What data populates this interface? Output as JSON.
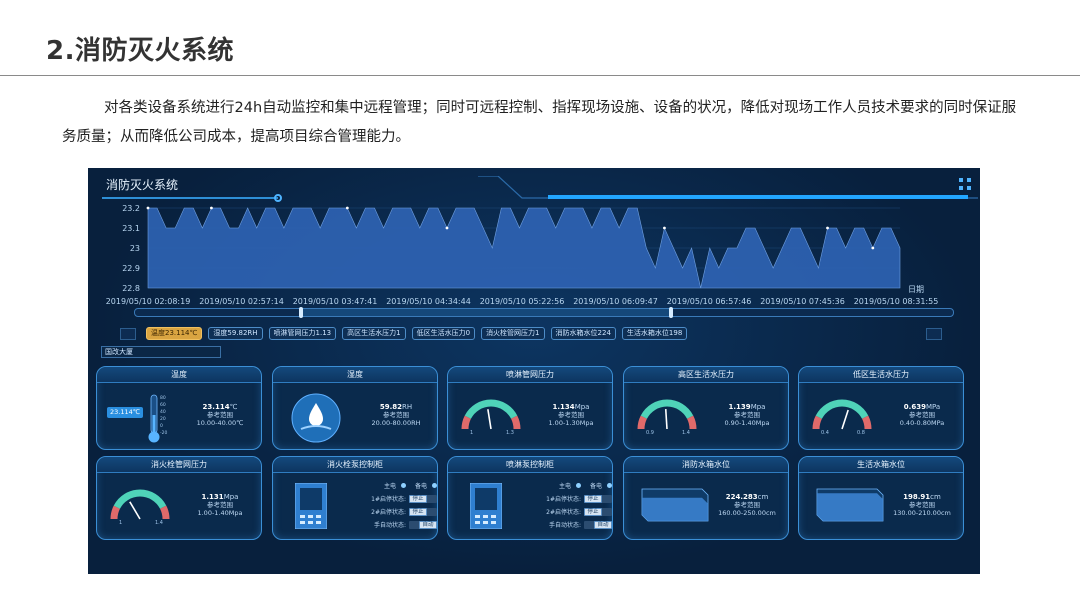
{
  "document": {
    "heading": "2.消防灭火系统",
    "paragraph": "对各类设备系统进行24h自动监控和集中远程管理；同时可远程控制、指挥现场设施、设备的状况，降低对现场工作人员技术要求的同时保证服务质量；从而降低公司成本，提高项目综合管理能力。"
  },
  "dashboard": {
    "title": "消防灭火系统",
    "area_input": "国改大厦",
    "tabs": [
      {
        "label": "温度23.114℃",
        "active": true
      },
      {
        "label": "湿度59.82RH",
        "active": false
      },
      {
        "label": "喷淋管网压力1.13",
        "active": false
      },
      {
        "label": "高区生活水压力1",
        "active": false
      },
      {
        "label": "低区生活水压力0",
        "active": false
      },
      {
        "label": "消火栓管网压力1",
        "active": false
      },
      {
        "label": "消防水箱水位224",
        "active": false
      },
      {
        "label": "生活水箱水位198",
        "active": false
      }
    ],
    "colors": {
      "background": "#08203d",
      "accent": "#3b8fd6",
      "active_tab": "#d9a441",
      "series": "#2f64b5"
    }
  },
  "chart_data": {
    "type": "area",
    "x_unit_label": "日期",
    "yticks": [
      "23.2",
      "23.1",
      "23",
      "22.9",
      "22.8"
    ],
    "ylim": [
      22.8,
      23.2
    ],
    "xticks": [
      "2019/05/10 02:08:19",
      "2019/05/10 02:57:14",
      "2019/05/10 03:47:41",
      "2019/05/10 04:34:44",
      "2019/05/10 05:22:56",
      "2019/05/10 06:09:47",
      "2019/05/10 06:57:46",
      "2019/05/10 07:45:36",
      "2019/05/10 08:31:55"
    ],
    "values": [
      23.2,
      23.2,
      23.1,
      23.1,
      23.2,
      23.2,
      23.1,
      23.2,
      23.2,
      23.1,
      23.1,
      23.2,
      23.1,
      23.2,
      23.2,
      23.1,
      23.2,
      23.2,
      23.2,
      23.1,
      23.2,
      23.2,
      23.2,
      23.1,
      23.2,
      23.2,
      23.1,
      23.2,
      23.2,
      23.2,
      23.1,
      23.2,
      23.2,
      23.1,
      23.2,
      23.2,
      23.2,
      23.1,
      23.0,
      23.2,
      23.2,
      23.1,
      23.2,
      23.2,
      23.2,
      23.1,
      23.2,
      23.2,
      23.2,
      23.1,
      23.2,
      23.2,
      23.1,
      23.2,
      23.2,
      23.0,
      22.9,
      23.1,
      23.0,
      22.9,
      23.0,
      22.8,
      23.0,
      22.9,
      23.0,
      23.0,
      23.1,
      23.1,
      23.0,
      22.9,
      23.0,
      23.1,
      23.1,
      23.0,
      22.9,
      23.1,
      23.1,
      23.0,
      23.1,
      23.1,
      23.0,
      23.1,
      23.1,
      23.0
    ]
  },
  "cards": [
    {
      "title": "温度",
      "value": "23.114",
      "unit": "℃",
      "ref_label": "参考范围",
      "ref_range": "10.00-40.00℃",
      "flag": "23.114℃",
      "thermo_ticks": [
        "80",
        "60",
        "40",
        "20",
        "0",
        "-20"
      ]
    },
    {
      "title": "湿度",
      "value": "59.82",
      "unit": "RH",
      "ref_label": "参考范围",
      "ref_range": "20.00-80.00RH"
    },
    {
      "title": "喷淋管网压力",
      "value": "1.134",
      "unit": "Mpa",
      "ref_label": "参考范围",
      "ref_range": "1.00-1.30Mpa",
      "gauge_min": "1",
      "gauge_max": "1.3",
      "level": 0.45
    },
    {
      "title": "高区生活水压力",
      "value": "1.139",
      "unit": "Mpa",
      "ref_label": "参考范围",
      "ref_range": "0.90-1.40Mpa",
      "gauge_min": "0.9",
      "gauge_max": "1.4",
      "level": 0.48
    },
    {
      "title": "低区生活水压力",
      "value": "0.639",
      "unit": "MPa",
      "ref_label": "参考范围",
      "ref_range": "0.40-0.80MPa",
      "gauge_min": "0.4",
      "gauge_max": "0.8",
      "level": 0.6
    },
    {
      "title": "消火栓管网压力",
      "value": "1.131",
      "unit": "Mpa",
      "ref_label": "参考范围",
      "ref_range": "1.00-1.40Mpa",
      "gauge_min": "1",
      "gauge_max": "1.4",
      "level": 0.33
    },
    {
      "title": "消火栓泵控制柜",
      "power_main": "主电",
      "power_backup": "备电",
      "rows": [
        {
          "label": "1#启停状态:",
          "badge": "停止"
        },
        {
          "label": "2#启停状态:",
          "badge": "停止"
        },
        {
          "label": "手自动状态:",
          "badge": "自动"
        }
      ]
    },
    {
      "title": "喷淋泵控制柜",
      "power_main": "主电",
      "power_backup": "备电",
      "rows": [
        {
          "label": "1#启停状态:",
          "badge": "停止"
        },
        {
          "label": "2#启停状态:",
          "badge": "停止"
        },
        {
          "label": "手自动状态:",
          "badge": "自动"
        }
      ]
    },
    {
      "title": "消防水箱水位",
      "value": "224.283",
      "unit": "cm",
      "ref_label": "参考范围",
      "ref_range": "160.00-250.00cm",
      "level": 0.71
    },
    {
      "title": "生活水箱水位",
      "value": "198.91",
      "unit": "cm",
      "ref_label": "参考范围",
      "ref_range": "130.00-210.00cm",
      "level": 0.86
    }
  ]
}
